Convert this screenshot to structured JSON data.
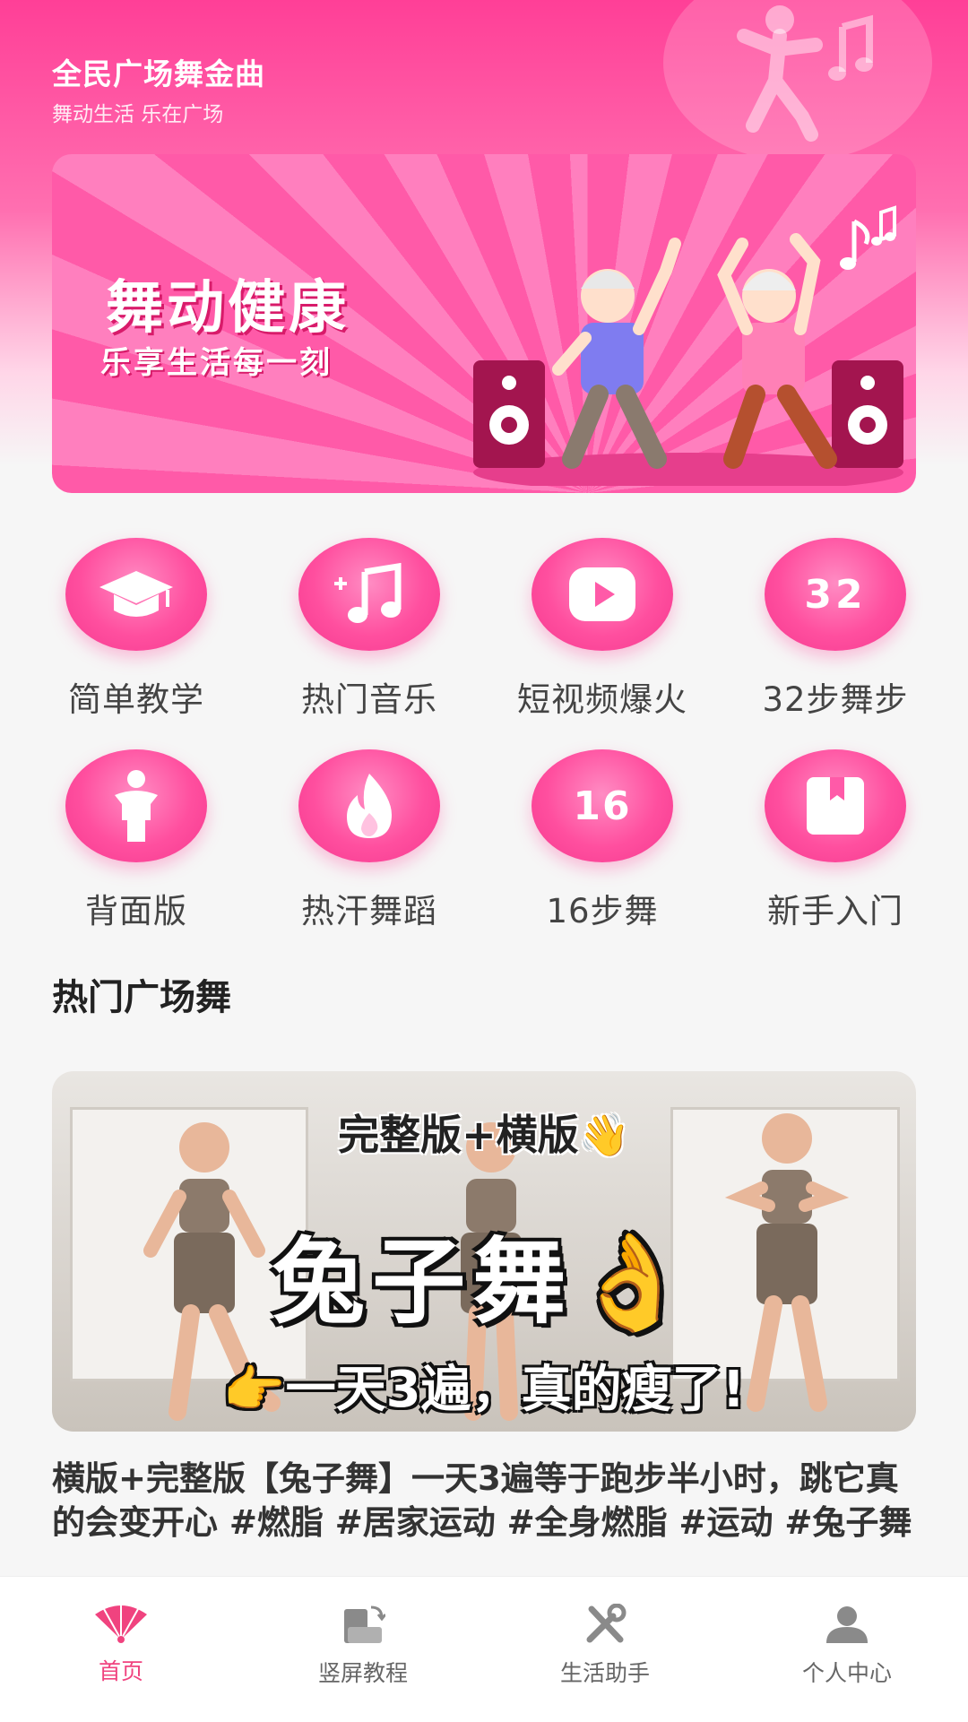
{
  "header": {
    "title": "全民广场舞金曲",
    "subtitle": "舞动生活 乐在广场"
  },
  "banner": {
    "headline": "舞动健康",
    "subline": "乐享生活每一刻"
  },
  "categories": [
    {
      "label": "简单教学",
      "icon": "graduation-cap-icon"
    },
    {
      "label": "热门音乐",
      "icon": "music-note-icon"
    },
    {
      "label": "短视频爆火",
      "icon": "play-icon"
    },
    {
      "label": "32步舞步",
      "icon": "number-32-icon",
      "icon_text": "32"
    },
    {
      "label": "背面版",
      "icon": "person-icon"
    },
    {
      "label": "热汗舞蹈",
      "icon": "flame-icon"
    },
    {
      "label": "16步舞",
      "icon": "number-16-icon",
      "icon_text": "16"
    },
    {
      "label": "新手入门",
      "icon": "bookmark-book-icon"
    }
  ],
  "section": {
    "title": "热门广场舞"
  },
  "video": {
    "thumb_top": "完整版+横版👋",
    "thumb_main": "兔子舞👌",
    "thumb_bottom": "👉一天3遍，真的瘦了!",
    "title": "横版+完整版【兔子舞】一天3遍等于跑步半小时，跳它真的会变开心 #燃脂 #居家运动 #全身燃脂 #运动 #兔子舞"
  },
  "tabbar": {
    "items": [
      {
        "label": "首页",
        "icon": "fan-icon",
        "active": true
      },
      {
        "label": "竖屏教程",
        "icon": "vertical-screen-icon",
        "active": false
      },
      {
        "label": "生活助手",
        "icon": "tools-icon",
        "active": false
      },
      {
        "label": "个人中心",
        "icon": "user-icon",
        "active": false
      }
    ]
  },
  "colors": {
    "accent": "#f0437f",
    "pink_bg": "#ff4f9f",
    "tab_inactive": "#666666"
  }
}
